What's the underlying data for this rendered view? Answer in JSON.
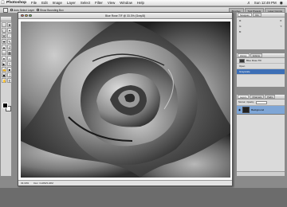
{
  "menubar": {
    "apple_icon": "apple-icon",
    "app_name": "Photoshop",
    "menus": [
      "File",
      "Edit",
      "Image",
      "Layer",
      "Select",
      "Filter",
      "View",
      "Window",
      "Help"
    ],
    "clock": "Sun 12:49 PM",
    "status_icons": [
      "volume-icon",
      "spotlight-icon"
    ]
  },
  "options_bar": {
    "checkbox_1_label": "Auto Select Layer",
    "checkbox_2_label": "Show Bounding Box",
    "tabs": [
      "Brushes",
      "Tool Presets",
      "Layer Comps"
    ]
  },
  "document": {
    "title": "Blue Rose.TIF @ 33.3% (Gray/8)",
    "zoom": "33.33%",
    "status": "Doc: 3.22M/3.22M",
    "image_icon": "rose-photo-image"
  },
  "navigator_panel": {
    "tabs": [
      "Navigator",
      "Info"
    ],
    "labels": [
      "R:",
      "G:",
      "B:",
      "X:",
      "Y:"
    ]
  },
  "history_panel": {
    "tabs": [
      "History",
      "Actions"
    ],
    "snapshot": "Blue Rose.TIF",
    "items": [
      "Open",
      "Grayscale"
    ],
    "selected": "Grayscale"
  },
  "layers_panel": {
    "tabs": [
      "Layers",
      "Channels",
      "Paths"
    ],
    "blend_mode": "Normal",
    "opacity_label": "Opacity:",
    "layers": [
      "Background"
    ]
  },
  "colors": {
    "selection": "#3d6fb6",
    "desktop": "#8a8a8a",
    "layer_highlight": "#7fa6d6"
  }
}
